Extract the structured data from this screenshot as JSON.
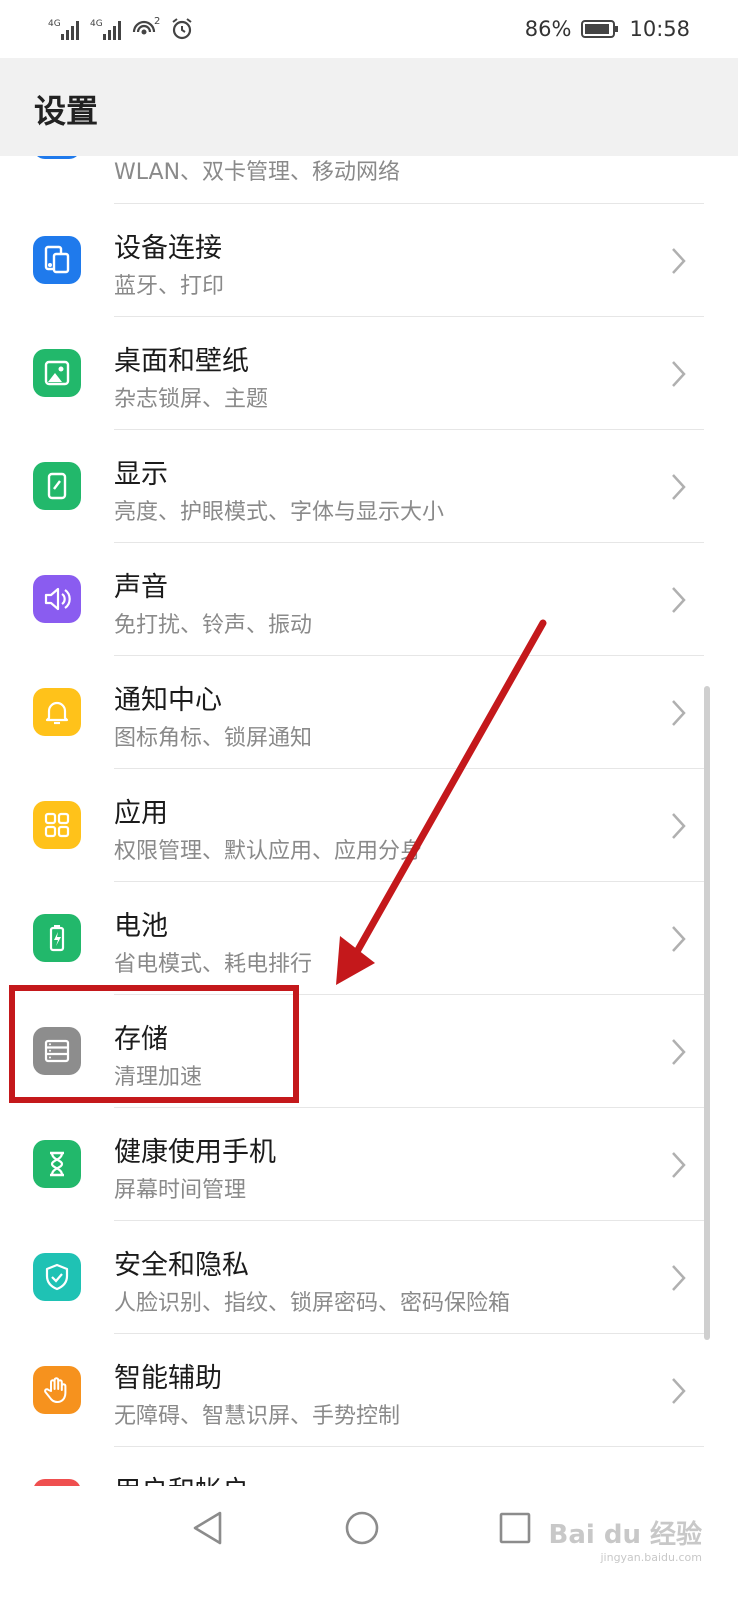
{
  "status_bar": {
    "network_1": "4G",
    "network_2": "4G",
    "wifi_badge": "2",
    "battery": "86%",
    "time": "10:58"
  },
  "header": {
    "title": "设置"
  },
  "settings": [
    {
      "title": "",
      "subtitle": "WLAN、双卡管理、移动网络",
      "icon": "network-icon",
      "color": "#1f7aec"
    },
    {
      "title": "设备连接",
      "subtitle": "蓝牙、打印",
      "icon": "device-connection-icon",
      "color": "#1f7aec"
    },
    {
      "title": "桌面和壁纸",
      "subtitle": "杂志锁屏、主题",
      "icon": "wallpaper-icon",
      "color": "#22b86b"
    },
    {
      "title": "显示",
      "subtitle": "亮度、护眼模式、字体与显示大小",
      "icon": "display-icon",
      "color": "#22b86b"
    },
    {
      "title": "声音",
      "subtitle": "免打扰、铃声、振动",
      "icon": "sound-icon",
      "color": "#8a5cf0"
    },
    {
      "title": "通知中心",
      "subtitle": "图标角标、锁屏通知",
      "icon": "notification-icon",
      "color": "#ffc21a"
    },
    {
      "title": "应用",
      "subtitle": "权限管理、默认应用、应用分身",
      "icon": "apps-icon",
      "color": "#ffc21a"
    },
    {
      "title": "电池",
      "subtitle": "省电模式、耗电排行",
      "icon": "battery-icon",
      "color": "#22b86b"
    },
    {
      "title": "存储",
      "subtitle": "清理加速",
      "icon": "storage-icon",
      "color": "#8d8d8d"
    },
    {
      "title": "健康使用手机",
      "subtitle": "屏幕时间管理",
      "icon": "hourglass-icon",
      "color": "#22b86b"
    },
    {
      "title": "安全和隐私",
      "subtitle": "人脸识别、指纹、锁屏密码、密码保险箱",
      "icon": "shield-icon",
      "color": "#1fc2b4"
    },
    {
      "title": "智能辅助",
      "subtitle": "无障碍、智慧识屏、手势控制",
      "icon": "hand-icon",
      "color": "#f6921e"
    },
    {
      "title": "用户和帐户",
      "subtitle": "",
      "icon": "account-icon",
      "color": "#ef4f4f"
    }
  ],
  "watermark": {
    "brand": "Bai du 经验",
    "url": "jingyan.baidu.com"
  },
  "annotation_color": "#c4181b"
}
